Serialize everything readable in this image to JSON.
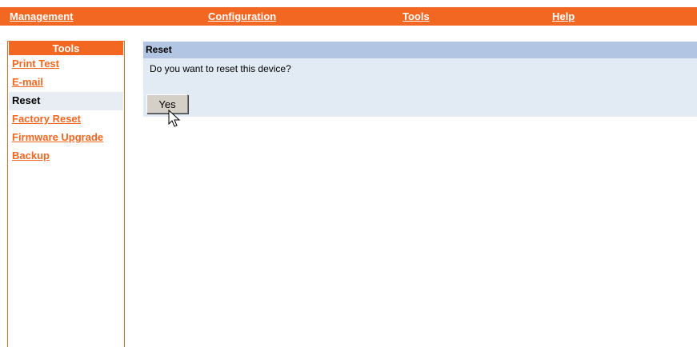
{
  "topnav": {
    "items": [
      "Management",
      "Configuration",
      "Tools",
      "Help"
    ]
  },
  "sidebar": {
    "title": "Tools",
    "items": [
      {
        "label": "Print Test",
        "active": false
      },
      {
        "label": "E-mail",
        "active": false
      },
      {
        "label": "Reset",
        "active": true
      },
      {
        "label": "Factory Reset",
        "active": false
      },
      {
        "label": "Firmware Upgrade",
        "active": false
      },
      {
        "label": "Backup",
        "active": false
      }
    ]
  },
  "panel": {
    "title": "Reset",
    "question": "Do you want to reset this device?",
    "yes_label": "Yes"
  },
  "colors": {
    "accent": "#f26722",
    "panel_header": "#b2c5e3",
    "panel_body": "#e2eaf3"
  },
  "icons": {
    "cursor": "mouse-pointer-icon"
  }
}
